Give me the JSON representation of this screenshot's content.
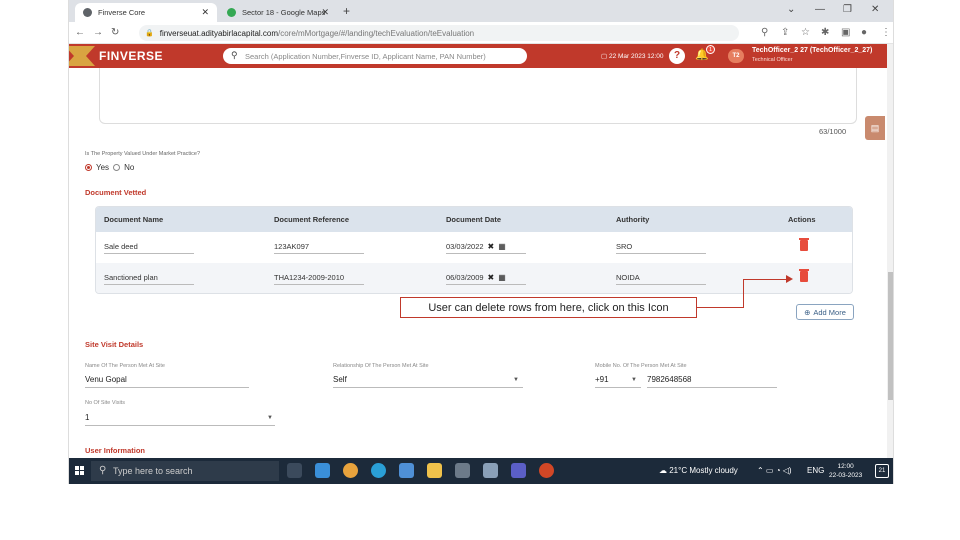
{
  "browser": {
    "tabs": [
      {
        "title": "Finverse Core",
        "icon": "chrome-icon",
        "active": true
      },
      {
        "title": "Sector 18 - Google Maps",
        "icon": "maps-pin-icon",
        "active": false
      }
    ],
    "url_domain": "finverseuat.adityabirlacapital.com",
    "url_path": "/core/mMortgage/#/landing/techEvaluation/teEvaluation"
  },
  "app": {
    "brand": "FINVERSE",
    "search_placeholder": "Search (Application Number,Finverse ID, Applicant Name, PAN Number)",
    "date": "22 Mar 2023 12:00",
    "notification_count": "1",
    "avatar_initials": "T2",
    "user_name": "TechOfficer_2 27 (TechOfficer_2_27)",
    "user_role": "Technical Officer"
  },
  "form": {
    "char_count": "63/1000",
    "market_question": "Is The Property Valued Under Market Practice?",
    "radio_yes": "Yes",
    "radio_no": "No",
    "selected": "Yes"
  },
  "document_vetted": {
    "title": "Document Vetted",
    "headers": [
      "Document Name",
      "Document Reference",
      "Document Date",
      "Authority",
      "Actions"
    ],
    "rows": [
      {
        "name": "Sale deed",
        "reference": "123AK097",
        "date": "03/03/2022",
        "authority": "SRO"
      },
      {
        "name": "Sanctioned plan",
        "reference": "THA1234-2009-2010",
        "date": "06/03/2009",
        "authority": "NOIDA"
      }
    ],
    "add_more": "Add More"
  },
  "annotation": "User can delete rows from here, click on this Icon",
  "site_visit": {
    "title": "Site Visit Details",
    "person_label": "Name Of The Person Met At Site",
    "person_value": "Venu Gopal",
    "relationship_label": "Relationship Of The Person Met At Site",
    "relationship_value": "Self",
    "mobile_label": "Mobile No. Of The Person Met At Site",
    "country_code": "+91",
    "mobile_value": "7982648568",
    "visits_label": "No Of Site Visits",
    "visits_value": "1"
  },
  "user_info_title": "User Information",
  "taskbar": {
    "search_placeholder": "Type here to search",
    "weather": "21°C  Mostly cloudy",
    "lang": "ENG",
    "time": "12:00",
    "date": "22-03-2023",
    "notif_count": "21"
  },
  "colors": {
    "brand": "#c0392b",
    "table_header": "#dbe3ec",
    "delete": "#e74c3c"
  }
}
